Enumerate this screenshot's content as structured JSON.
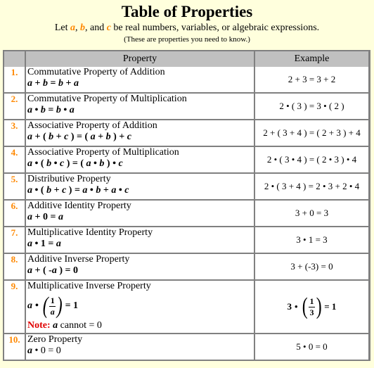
{
  "header": {
    "title": "Table of Properties",
    "subtitle_prefix": "Let ",
    "var_a": "a",
    "sep1": ", ",
    "var_b": "b",
    "sep2": ", and ",
    "var_c": "c",
    "subtitle_suffix": " be real numbers, variables, or algebraic expressions.",
    "note": "(These are properties you need to know.)"
  },
  "colors": {
    "background": "#ffffdd",
    "accent": "#ff8800",
    "note": "#e00000",
    "header_bg": "#c0c0c0",
    "border": "#808080"
  },
  "table": {
    "columns": [
      "",
      "Property",
      "Example"
    ],
    "rows": [
      {
        "num": "1.",
        "name": "Commutative Property of Addition",
        "formula": "a + b = b + a",
        "example": "2 + 3 = 3 + 2"
      },
      {
        "num": "2.",
        "name": "Commutative Property of Multiplication",
        "formula": "a • b = b • a",
        "example": "2 • ( 3 ) = 3 • ( 2 )"
      },
      {
        "num": "3.",
        "name": "Associative Property of Addition",
        "formula": "a + ( b + c ) = ( a + b ) + c",
        "example": "2 + ( 3 + 4 ) = ( 2 + 3 ) + 4"
      },
      {
        "num": "4.",
        "name": "Associative Property of Multiplication",
        "formula": "a • ( b • c ) = ( a • b ) • c",
        "example": "2 • ( 3 • 4 ) = ( 2 • 3 ) • 4"
      },
      {
        "num": "5.",
        "name": "Distributive Property",
        "formula": "a • ( b + c ) = a • b + a • c",
        "example": "2 • ( 3 + 4 ) = 2 •  3 + 2 • 4"
      },
      {
        "num": "6.",
        "name": "Additive Identity Property",
        "formula": "a + 0 = a",
        "example": "3 + 0 = 3"
      },
      {
        "num": "7.",
        "name": "Multiplicative Identity Property",
        "formula": "a •  1 = a",
        "example": "3 • 1  = 3"
      },
      {
        "num": "8.",
        "name": "Additive Inverse Property",
        "formula": "a + ( -a ) = 0",
        "example": "3 + (-3) = 0"
      },
      {
        "num": "9.",
        "name": "Multiplicative Inverse Property",
        "formula": {
          "base": "a",
          "dot": "•",
          "numerator": "1",
          "denominator": "a",
          "result": "= 1"
        },
        "note_label": "Note:",
        "note_var": "a",
        "note_text": " cannot = 0",
        "example": {
          "base": "3",
          "dot": "•",
          "numerator": "1",
          "denominator": "3",
          "result": "= 1"
        }
      },
      {
        "num": "10.",
        "name": "Zero Property",
        "formula_var": "a",
        "formula_rest": " • 0 = 0",
        "example": "5 • 0 = 0"
      }
    ]
  }
}
